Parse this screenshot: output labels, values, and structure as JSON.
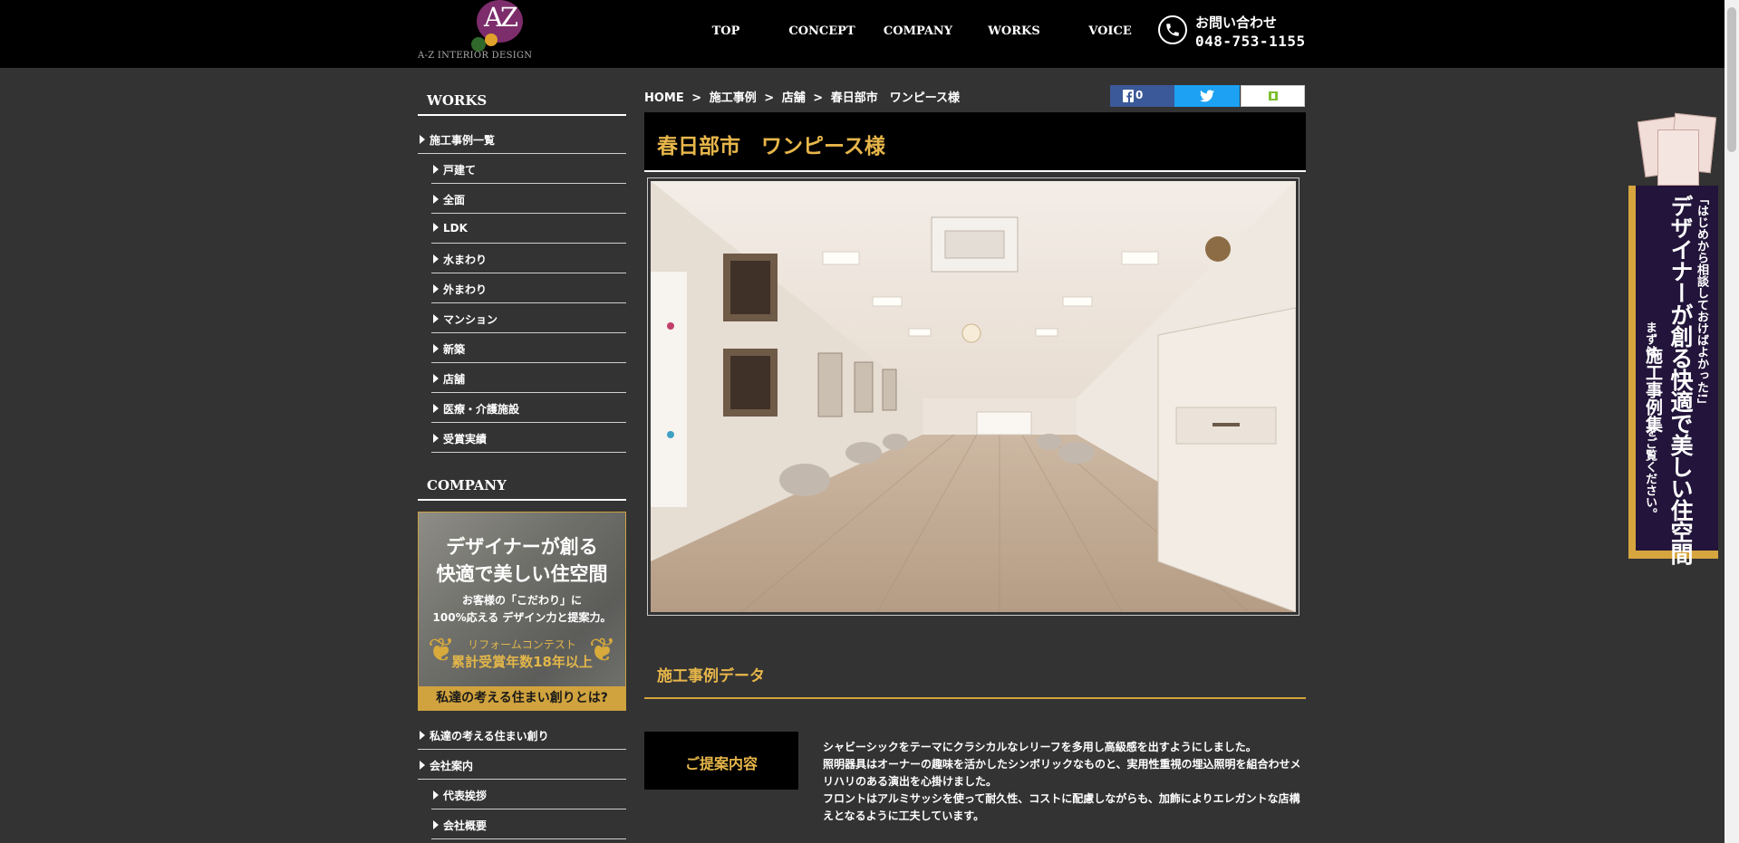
{
  "header": {
    "logo_mark": "AZ",
    "logo_name": "A-Z INTERIOR DESIGN",
    "nav": [
      {
        "label": "TOP"
      },
      {
        "label": "CONCEPT"
      },
      {
        "label": "COMPANY"
      },
      {
        "label": "WORKS"
      },
      {
        "label": "VOICE"
      }
    ],
    "contact_label": "お問い合わせ",
    "contact_tel": "048-753-1155"
  },
  "sidebar": {
    "works_heading": "WORKS",
    "works_items": [
      {
        "label": "施工事例一覧"
      },
      {
        "label": "戸建て"
      },
      {
        "label": "全面"
      },
      {
        "label": "LDK"
      },
      {
        "label": "水まわり"
      },
      {
        "label": "外まわり"
      },
      {
        "label": "マンション"
      },
      {
        "label": "新築"
      },
      {
        "label": "店舗"
      },
      {
        "label": "医療・介護施設"
      },
      {
        "label": "受賞実績"
      }
    ],
    "company_heading": "COMPANY",
    "banner": {
      "line1": "デザイナーが創る",
      "line2": "快適で美しい住空間",
      "sub1": "お客様の「こだわり」に",
      "sub2": "100%応える デザイン力と提案力。",
      "award1": "リフォームコンテスト",
      "award2": "累計受賞年数18年以上",
      "footer": "私達の考える住まい創りとは?"
    },
    "company_items": [
      {
        "label": "私達の考える住まい創り"
      },
      {
        "label": "会社案内"
      },
      {
        "label": "代表挨拶"
      },
      {
        "label": "会社概要"
      }
    ]
  },
  "main": {
    "breadcrumb": [
      "HOME",
      ">",
      "施工事例",
      ">",
      "店舗",
      ">",
      "春日部市　ワンピース様"
    ],
    "share": {
      "facebook_count": "0"
    },
    "title": "春日部市　ワンピース様",
    "section_title": "施工事例データ",
    "proposal_label": "ご提案内容",
    "proposal_lines": [
      "シャビーシックをテーマにクラシカルなレリーフを多用し高級感を出すようにしました。",
      "照明器具はオーナーの趣味を活かしたシンボリックなものと、実用性重視の埋込照明を組合わせメリハリのある演出を心掛けました。",
      "フロントはアルミサッシを使って耐久性、コストに配慮しながらも、加飾によりエレガントな店構えとなるように工夫しています。"
    ]
  },
  "side_banner": {
    "line1": "「はじめから相談しておけばよかった!」",
    "line2": "デザイナーが創る快適で美しい住空間",
    "line3": "まずは",
    "line4": "施工事例集",
    "line5": "をご覧ください。"
  },
  "colors": {
    "accent_gold": "#e7b64a",
    "background": "#333333",
    "header": "#000000",
    "facebook": "#3b5998",
    "twitter": "#1da1f2"
  }
}
